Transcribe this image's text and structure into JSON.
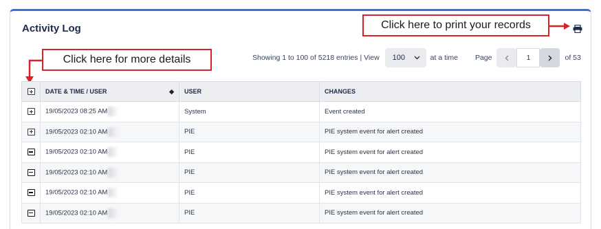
{
  "panel": {
    "title": "Activity Log"
  },
  "callouts": {
    "print": "Click here to print your records",
    "details": "Click here for more details"
  },
  "pagination": {
    "showing": "Showing 1 to 100 of 5218 entries | View",
    "page_size": "100",
    "at_a_time": "at a time",
    "page_label": "Page",
    "current_page": "1",
    "of_pages": "of 53",
    "prev_icon": "chevron-left-icon",
    "next_icon": "chevron-right-icon"
  },
  "table": {
    "headers": {
      "date": "DATE & TIME / USER",
      "user": "USER",
      "changes": "CHANGES"
    },
    "rows": [
      {
        "date": "19/05/2023 08:25 AM",
        "user": "System",
        "changes": "Event created"
      },
      {
        "date": "19/05/2023 02:10 AM",
        "user": "PIE",
        "changes": "PIE system event for alert created"
      },
      {
        "date": "19/05/2023 02:10 AM",
        "user": "PIE",
        "changes": "PIE system event for alert created"
      },
      {
        "date": "19/05/2023 02:10 AM",
        "user": "PIE",
        "changes": "PIE system event for alert created"
      },
      {
        "date": "19/05/2023 02:10 AM",
        "user": "PIE",
        "changes": "PIE system event for alert created"
      },
      {
        "date": "19/05/2023 02:10 AM",
        "user": "PIE",
        "changes": "PIE system event for alert created"
      }
    ]
  },
  "colors": {
    "accent": "#3b6fd8",
    "callout_border": "#d9212a"
  }
}
